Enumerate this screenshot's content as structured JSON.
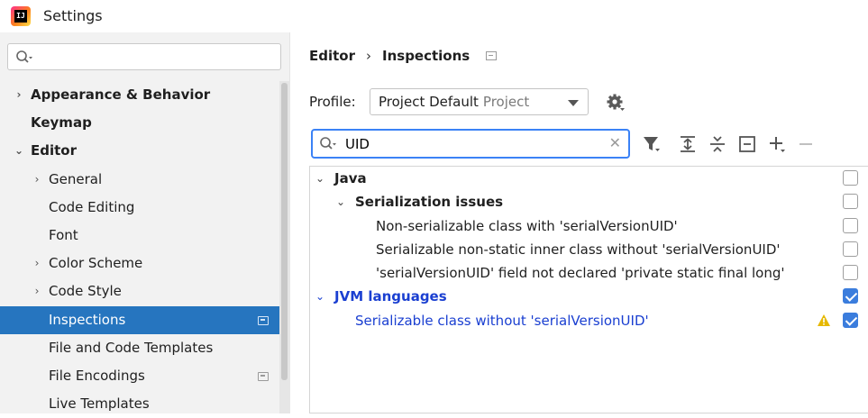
{
  "window": {
    "title": "Settings",
    "app_icon_text": "IJ"
  },
  "sidebar": {
    "search": {
      "value": "",
      "placeholder": ""
    },
    "items": [
      {
        "label": "Appearance & Behavior",
        "level": 0,
        "bold": true,
        "arrow": "›"
      },
      {
        "label": "Keymap",
        "level": 0,
        "bold": true,
        "arrow": ""
      },
      {
        "label": "Editor",
        "level": 0,
        "bold": true,
        "arrow": "⌄"
      },
      {
        "label": "General",
        "level": 1,
        "bold": false,
        "arrow": "›"
      },
      {
        "label": "Code Editing",
        "level": 1,
        "bold": false,
        "arrow": ""
      },
      {
        "label": "Font",
        "level": 1,
        "bold": false,
        "arrow": ""
      },
      {
        "label": "Color Scheme",
        "level": 1,
        "bold": false,
        "arrow": "›"
      },
      {
        "label": "Code Style",
        "level": 1,
        "bold": false,
        "arrow": "›"
      },
      {
        "label": "Inspections",
        "level": 1,
        "bold": false,
        "arrow": "",
        "selected": true,
        "badge": true
      },
      {
        "label": "File and Code Templates",
        "level": 1,
        "bold": false,
        "arrow": ""
      },
      {
        "label": "File Encodings",
        "level": 1,
        "bold": false,
        "arrow": "",
        "badge": true
      },
      {
        "label": "Live Templates",
        "level": 1,
        "bold": false,
        "arrow": ""
      }
    ]
  },
  "main": {
    "breadcrumb": {
      "parent": "Editor",
      "separator": "›",
      "current": "Inspections"
    },
    "profile": {
      "label": "Profile:",
      "value": "Project Default",
      "scope": "Project"
    },
    "filter": {
      "value": "UID",
      "placeholder": ""
    },
    "toolbar": [
      "filter-icon",
      "expand-all-icon",
      "collapse-all-icon",
      "reset-icon",
      "add-icon",
      "remove-icon"
    ],
    "inspections": [
      {
        "label": "Java",
        "level": 0,
        "arrow": "⌄",
        "bold": true,
        "checked": false
      },
      {
        "label": "Serialization issues",
        "level": 1,
        "arrow": "⌄",
        "bold": true,
        "checked": false
      },
      {
        "label": "Non-serializable class with 'serialVersionUID'",
        "level": 2,
        "arrow": "",
        "checked": false
      },
      {
        "label": "Serializable non-static inner class without 'serialVersionUID'",
        "level": 2,
        "arrow": "",
        "checked": false
      },
      {
        "label": "'serialVersionUID' field not declared 'private static final long'",
        "level": 2,
        "arrow": "",
        "checked": false
      },
      {
        "label": "JVM languages",
        "level": 0,
        "arrow": "⌄",
        "bold": true,
        "blue": true,
        "checked": true
      },
      {
        "label": "Serializable class without 'serialVersionUID'",
        "level": 1,
        "arrow": "",
        "blue": true,
        "checked": true,
        "warning": true
      }
    ]
  },
  "colors": {
    "selection": "#2675bf",
    "accent_blue": "#1a3fd1",
    "checkbox_on": "#3b7ddd",
    "warning": "#e6b800"
  }
}
